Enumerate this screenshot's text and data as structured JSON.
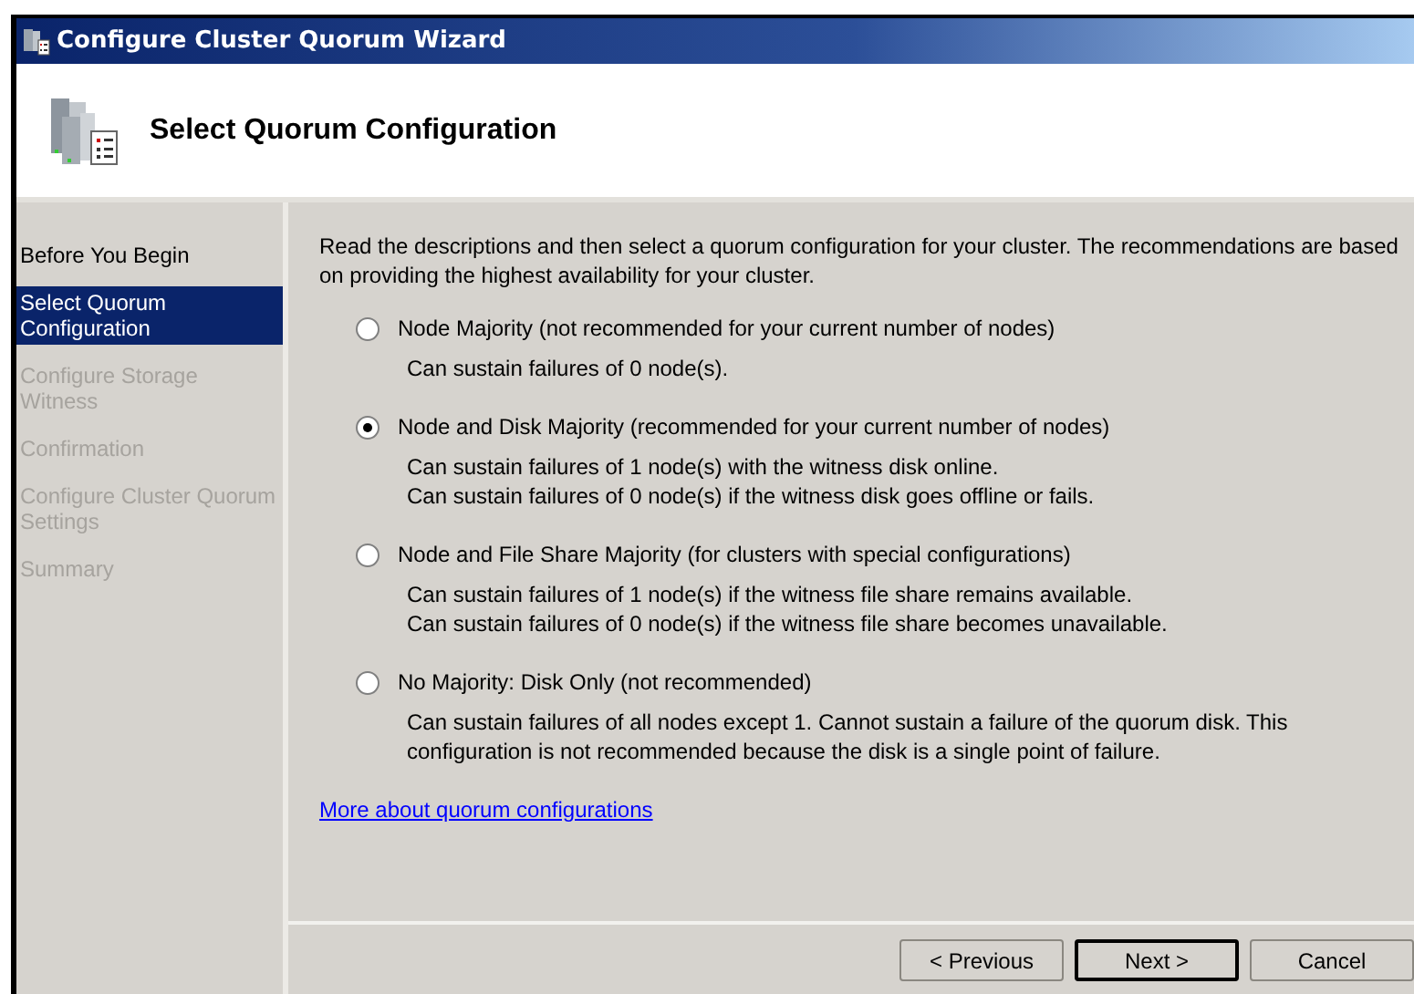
{
  "window": {
    "title": "Configure Cluster Quorum Wizard"
  },
  "header": {
    "title": "Select Quorum Configuration"
  },
  "sidebar": {
    "items": [
      {
        "label": "Before You Begin",
        "selected": false,
        "disabled": false
      },
      {
        "label": "Select Quorum Configuration",
        "selected": true,
        "disabled": false
      },
      {
        "label": "Configure Storage Witness",
        "selected": false,
        "disabled": true
      },
      {
        "label": "Confirmation",
        "selected": false,
        "disabled": true
      },
      {
        "label": "Configure Cluster Quorum Settings",
        "selected": false,
        "disabled": true
      },
      {
        "label": "Summary",
        "selected": false,
        "disabled": true
      }
    ]
  },
  "intro": "Read the descriptions and then select a quorum configuration for your cluster. The recommendations are based on providing the highest availability for your cluster.",
  "options": [
    {
      "label": "Node Majority (not recommended for your current number of nodes)",
      "selected": false,
      "details": [
        "Can sustain failures of 0 node(s)."
      ]
    },
    {
      "label": "Node and Disk Majority (recommended for your current number of nodes)",
      "selected": true,
      "details": [
        "Can sustain failures of 1 node(s) with the witness disk online.",
        "Can sustain failures of 0 node(s) if the witness disk goes offline or fails."
      ]
    },
    {
      "label": "Node and File Share Majority (for clusters with special configurations)",
      "selected": false,
      "details": [
        "Can sustain failures of 1 node(s) if the witness file share remains available.",
        "Can sustain failures of 0 node(s) if the witness file share becomes unavailable."
      ]
    },
    {
      "label": "No Majority: Disk Only (not recommended)",
      "selected": false,
      "details": [
        "Can sustain failures of all nodes except 1. Cannot sustain a failure of the quorum disk. This configuration is not recommended because the disk is a single point of failure."
      ]
    }
  ],
  "link": "More about quorum configurations",
  "buttons": [
    {
      "label": "< Previous",
      "default": false
    },
    {
      "label": "Next >",
      "default": true
    },
    {
      "label": "Cancel",
      "default": false
    }
  ]
}
